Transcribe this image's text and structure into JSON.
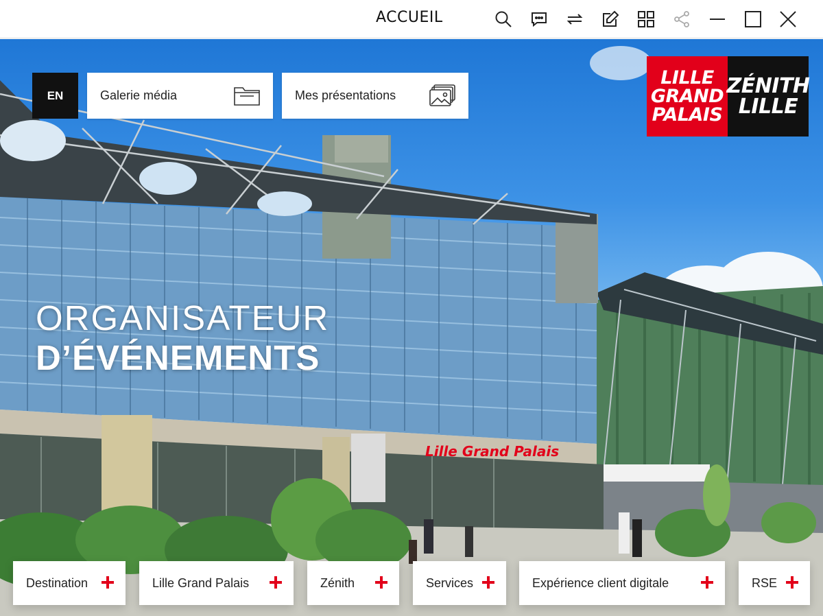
{
  "toolbar": {
    "home_label": "ACCUEIL",
    "icons": [
      "search-icon",
      "chat-icon",
      "switch-icon",
      "edit-icon",
      "grid-icon",
      "share-icon",
      "minimize-icon",
      "maximize-icon",
      "close-icon"
    ]
  },
  "hero": {
    "lang_label": "EN",
    "media_gallery_label": "Galerie média",
    "presentations_label": "Mes présentations",
    "headline_line1": "ORGANISATEUR",
    "headline_line2": "D’ÉVÉNEMENTS",
    "building_sign": "Lille Grand Palais"
  },
  "logo": {
    "lgp_lines": [
      "LILLE",
      "GRAND",
      "PALAIS"
    ],
    "zenith_lines": [
      "ZÉNITH",
      "LILLE"
    ],
    "lgp_color": "#e2001a",
    "zenith_color": "#111111"
  },
  "nav": {
    "items": [
      {
        "label": "Destination"
      },
      {
        "label": "Lille Grand Palais"
      },
      {
        "label": "Zénith"
      },
      {
        "label": "Services"
      },
      {
        "label": "Expérience client digitale"
      },
      {
        "label": "RSE"
      }
    ],
    "accent_color": "#e2001a"
  }
}
